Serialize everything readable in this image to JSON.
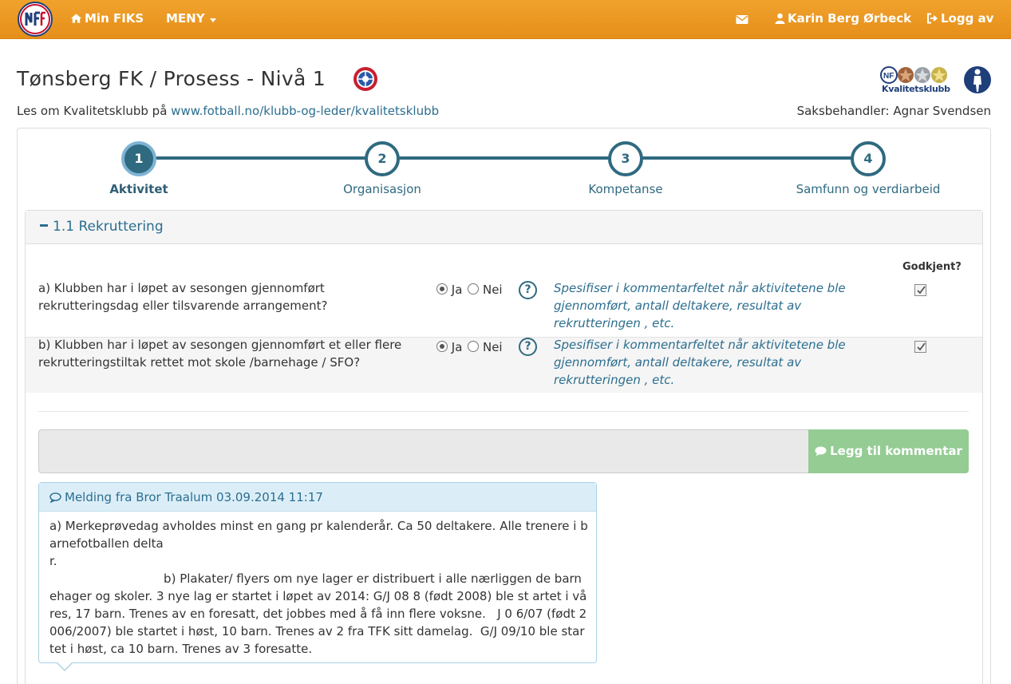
{
  "navbar": {
    "home_label": "Min FIKS",
    "menu_label": "MENY",
    "user_label": "Karin Berg Ørbeck",
    "logout_label": "Logg av"
  },
  "header": {
    "title": "Tønsberg FK / Prosess - Nivå 1",
    "lead_text": "Les om Kvalitetsklubb på ",
    "lead_link": "www.fotball.no/klubb-og-leder/kvalitetsklubb",
    "saksbehandler": "Saksbehandler: Agnar Svendsen",
    "kk_logo_text": "Kvalitetsklubb"
  },
  "steps": [
    {
      "number": "1",
      "label": "Aktivitet",
      "active": true
    },
    {
      "number": "2",
      "label": "Organisasjon",
      "active": false
    },
    {
      "number": "3",
      "label": "Kompetanse",
      "active": false
    },
    {
      "number": "4",
      "label": "Samfunn og verdiarbeid",
      "active": false
    }
  ],
  "section": {
    "title": "1.1 Rekruttering",
    "godkjent_header": "Godkjent?",
    "yes_label": "Ja",
    "no_label": "Nei",
    "questions": [
      {
        "text": "a) Klubben har i løpet av sesongen gjennomført rekrutteringsdag eller tilsvarende arrangement?",
        "answer": "Ja",
        "hint": "Spesifiser i kommentarfeltet når aktivitetene ble gjennomført, antall deltakere, resultat av rekrutteringen , etc.",
        "approved": true
      },
      {
        "text": "b) Klubben har i løpet av sesongen gjennomført et eller flere rekrutteringstiltak rettet mot skole /barnehage / SFO?",
        "answer": "Ja",
        "hint": "Spesifiser i kommentarfeltet når aktivitetene ble gjennomført, antall deltakere, resultat av rekrutteringen , etc.",
        "approved": true
      }
    ]
  },
  "comment": {
    "input_value": "",
    "button_label": "Legg til kommentar"
  },
  "message": {
    "title": "Melding fra Bror Traalum 03.09.2014 11:17",
    "body": "a) Merkeprøvedag avholdes minst en gang pr kalenderår. Ca 50 deltakere. Alle trenere i barnefotballen delta\nr.\n                              b) Plakater/ flyers om nye lager er distribuert i alle nærliggen de barnehager og skoler. 3 nye lag er startet i løpet av 2014: G/J 08 8 (født 2008) ble st artet i våres, 17 barn. Trenes av en foresatt, det jobbes med å få inn flere voksne.   J 0 6/07 (født 2006/2007) ble startet i høst, 10 barn. Trenes av 2 fra TFK sitt damelag.  G/J 09/10 ble startet i høst, ca 10 barn. Trenes av 3 foresatte."
  },
  "colors": {
    "navbar": "#e8961f",
    "primary": "#2f6a80",
    "link": "#2c6e8f",
    "success_button": "#94cc94"
  }
}
